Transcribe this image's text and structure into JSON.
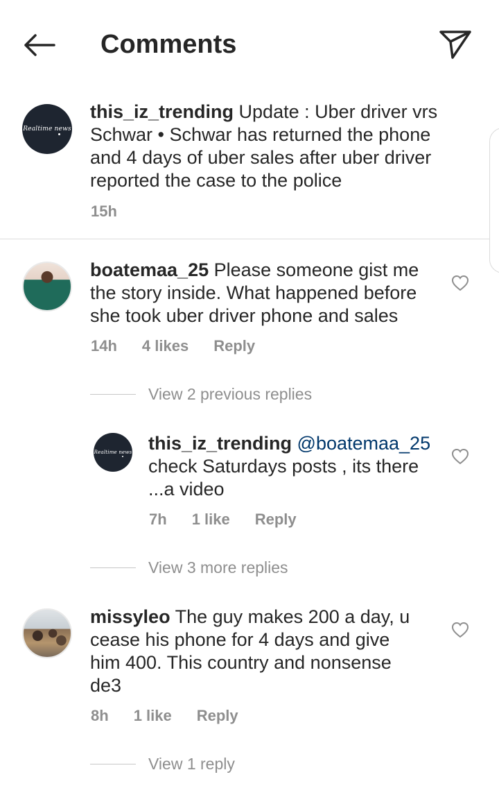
{
  "header": {
    "title": "Comments",
    "back_icon": "arrow-left-icon",
    "share_icon": "paper-plane-icon"
  },
  "caption": {
    "avatar_text": "Realtime news",
    "username": "this_iz_trending",
    "text": "Update : Uber driver vrs Schwar • Schwar has returned the phone and 4 days of uber sales after uber driver reported the case to the police",
    "time": "15h"
  },
  "comments": [
    {
      "username": "boatemaa_25",
      "text": "Please someone gist me the story inside. What happened before she took uber driver phone and sales",
      "time": "14h",
      "likes": "4 likes",
      "reply": "Reply",
      "view_replies": "View 2 previous replies",
      "reply_item": {
        "avatar_text": "Realtime news",
        "username": "this_iz_trending",
        "mention": "@boatemaa_25",
        "text": "check Saturdays posts , its there ...a video",
        "time": "7h",
        "likes": "1 like",
        "reply": "Reply"
      },
      "view_more": "View 3 more replies"
    },
    {
      "username": "missyleo",
      "text": "The guy makes 200 a day, u cease his phone for 4 days and give him 400. This country and nonsense de3",
      "time": "8h",
      "likes": "1 like",
      "reply": "Reply",
      "view_replies": "View 1 reply"
    }
  ],
  "colors": {
    "text": "#262626",
    "meta": "#8e8e8e",
    "mention": "#00376b",
    "divider": "#dbdbdb"
  }
}
